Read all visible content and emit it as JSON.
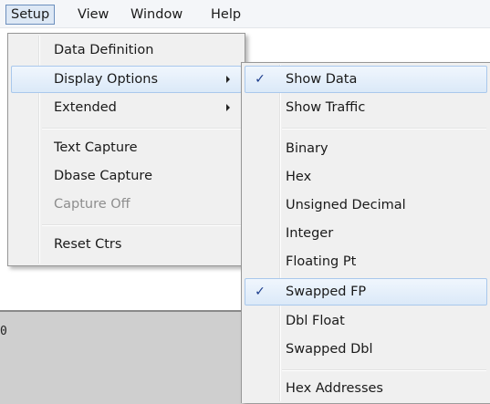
{
  "menubar": {
    "items": [
      {
        "label": "Setup",
        "open": true
      },
      {
        "label": "View"
      },
      {
        "label": "Window"
      },
      {
        "label": "Help"
      }
    ]
  },
  "setup_menu": {
    "items": [
      {
        "label": "Data Definition"
      },
      {
        "label": "Display Options",
        "has_submenu": true,
        "highlighted": true
      },
      {
        "label": "Extended",
        "has_submenu": true
      },
      {
        "label": "Text Capture"
      },
      {
        "label": "Dbase Capture"
      },
      {
        "label": "Capture Off",
        "disabled": true
      },
      {
        "label": "Reset Ctrs"
      }
    ]
  },
  "display_options_menu": {
    "check_glyph": "✓",
    "items": [
      {
        "label": "Show Data",
        "checked": true,
        "highlighted": true
      },
      {
        "label": "Show Traffic"
      },
      {
        "label": "Binary"
      },
      {
        "label": "Hex"
      },
      {
        "label": "Unsigned Decimal"
      },
      {
        "label": "Integer"
      },
      {
        "label": "Floating Pt"
      },
      {
        "label": "Swapped FP",
        "checked": true,
        "highlighted": true
      },
      {
        "label": "Dbl Float"
      },
      {
        "label": "Swapped Dbl"
      },
      {
        "label": "Hex Addresses"
      }
    ]
  },
  "background": {
    "edge_text": "0"
  },
  "colors": {
    "highlight_border": "#a9c8ec",
    "menu_bg": "#f0f0f0",
    "check_color": "#1a3c8c",
    "disabled_text": "#8d8d8d"
  }
}
